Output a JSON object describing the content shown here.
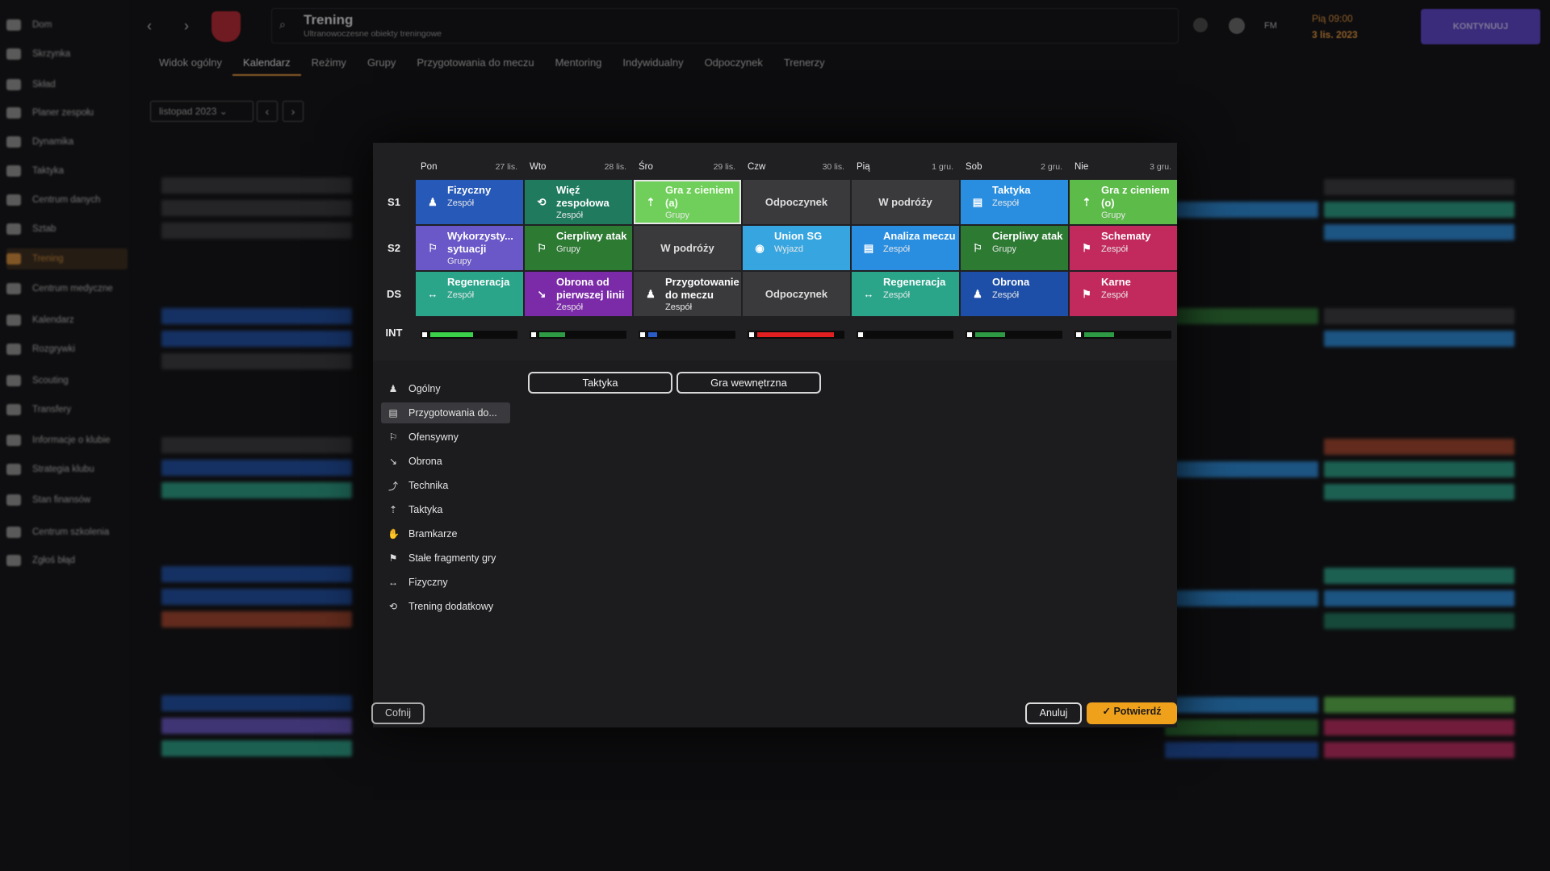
{
  "sidebar": {
    "items": [
      {
        "label": "Dom"
      },
      {
        "label": "Skrzynka"
      },
      {
        "label": "Skład"
      },
      {
        "label": "Planer zespołu"
      },
      {
        "label": "Dynamika"
      },
      {
        "label": "Taktyka"
      },
      {
        "label": "Centrum danych"
      },
      {
        "label": "Sztab"
      },
      {
        "label": "Trening"
      },
      {
        "label": "Centrum medyczne"
      },
      {
        "label": "Kalendarz"
      },
      {
        "label": "Rozgrywki"
      },
      {
        "label": "Scouting"
      },
      {
        "label": "Transfery"
      },
      {
        "label": "Informacje o klubie"
      },
      {
        "label": "Strategia klubu"
      },
      {
        "label": "Stan finansów"
      },
      {
        "label": "Centrum szkolenia"
      },
      {
        "label": "Zgłoś błąd"
      }
    ]
  },
  "header": {
    "title": "Trening",
    "subtitle": "Ultranowoczesne obiekty treningowe",
    "date_line1": "Pią 09:00",
    "date_line2": "3 lis. 2023",
    "continue_label": "KONTYNUUJ",
    "initials": "FM"
  },
  "tabs": [
    {
      "label": "Widok ogólny"
    },
    {
      "label": "Kalendarz"
    },
    {
      "label": "Reżimy"
    },
    {
      "label": "Grupy"
    },
    {
      "label": "Przygotowania do meczu"
    },
    {
      "label": "Mentoring"
    },
    {
      "label": "Indywidualny"
    },
    {
      "label": "Odpoczynek"
    },
    {
      "label": "Trenerzy"
    }
  ],
  "month_selector": {
    "value": "listopad 2023"
  },
  "calendar": {
    "days": [
      {
        "name": "Pon",
        "date": "27 lis."
      },
      {
        "name": "Wto",
        "date": "28 lis."
      },
      {
        "name": "Śro",
        "date": "29 lis."
      },
      {
        "name": "Czw",
        "date": "30 lis."
      },
      {
        "name": "Pią",
        "date": "1 gru."
      },
      {
        "name": "Sob",
        "date": "2 gru."
      },
      {
        "name": "Nie",
        "date": "3 gru."
      }
    ],
    "rows": [
      {
        "label": "S1",
        "cells": [
          {
            "title": "Fizyczny",
            "sub": "Zespół",
            "color": "#2659b8",
            "icon": "person-icon"
          },
          {
            "title": "Więź zespołowa",
            "sub": "Zespół",
            "color": "#1f7a5e",
            "icon": "team-icon"
          },
          {
            "title": "Gra z cieniem (a)",
            "sub": "Grupy",
            "color": "#6fcf5a",
            "icon": "tactics-icon"
          },
          {
            "title": "Odpoczynek",
            "sub": "",
            "color": "#3a3a3d",
            "icon": ""
          },
          {
            "title": "W podróży",
            "sub": "",
            "color": "#3a3a3d",
            "icon": ""
          },
          {
            "title": "Taktyka",
            "sub": "Zespół",
            "color": "#2a8ee0",
            "icon": "clipboard-icon"
          },
          {
            "title": "Gra z cieniem (o)",
            "sub": "Grupy",
            "color": "#5dbb4a",
            "icon": "tactics-icon"
          }
        ]
      },
      {
        "label": "S2",
        "cells": [
          {
            "title": "Wykorzysty... sytuacji",
            "sub": "Grupy",
            "color": "#6a57c8",
            "icon": "run-icon"
          },
          {
            "title": "Cierpliwy atak",
            "sub": "Grupy",
            "color": "#2d7a33",
            "icon": "run-icon"
          },
          {
            "title": "W podróży",
            "sub": "",
            "color": "#3a3a3d",
            "icon": ""
          },
          {
            "title": "Union SG",
            "sub": "Wyjazd",
            "color": "#37a6e0",
            "icon": "club-crest-icon"
          },
          {
            "title": "Analiza meczu",
            "sub": "Zespół",
            "color": "#2a8ee0",
            "icon": "clipboard-icon"
          },
          {
            "title": "Cierpliwy atak",
            "sub": "Grupy",
            "color": "#2d7a33",
            "icon": "run-icon"
          },
          {
            "title": "Schematy",
            "sub": "Zespół",
            "color": "#c22a5e",
            "icon": "flag-icon"
          }
        ]
      },
      {
        "label": "DS",
        "cells": [
          {
            "title": "Regeneracja",
            "sub": "Zespół",
            "color": "#2aa58a",
            "icon": "arrows-icon"
          },
          {
            "title": "Obrona od pierwszej linii",
            "sub": "Zespół",
            "color": "#7b2aa8",
            "icon": "slide-icon"
          },
          {
            "title": "Przygotowanie do meczu",
            "sub": "Zespół",
            "color": "#3a3a3d",
            "icon": "person-icon"
          },
          {
            "title": "Odpoczynek",
            "sub": "",
            "color": "#3a3a3d",
            "icon": ""
          },
          {
            "title": "Regeneracja",
            "sub": "Zespół",
            "color": "#2aa58a",
            "icon": "arrows-icon"
          },
          {
            "title": "Obrona",
            "sub": "Zespół",
            "color": "#1d4fa8",
            "icon": "person-icon"
          },
          {
            "title": "Karne",
            "sub": "Zespół",
            "color": "#c22a5e",
            "icon": "flag-icon"
          }
        ]
      }
    ],
    "int_label": "INT",
    "intensity": [
      {
        "level": 0.5,
        "color": "#3ad04a"
      },
      {
        "level": 0.3,
        "color": "#2f9a44"
      },
      {
        "level": 0.1,
        "color": "#2a5cc8"
      },
      {
        "level": 0.9,
        "color": "#e02020"
      },
      {
        "level": 0.0,
        "color": "#2f9a44"
      },
      {
        "level": 0.35,
        "color": "#2f9a44"
      },
      {
        "level": 0.35,
        "color": "#2f9a44"
      }
    ]
  },
  "categories": [
    {
      "label": "Ogólny",
      "icon": "person-icon"
    },
    {
      "label": "Przygotowania do...",
      "icon": "clipboard-icon"
    },
    {
      "label": "Ofensywny",
      "icon": "run-icon"
    },
    {
      "label": "Obrona",
      "icon": "slide-icon"
    },
    {
      "label": "Technika",
      "icon": "kick-icon"
    },
    {
      "label": "Taktyka",
      "icon": "tactics-icon"
    },
    {
      "label": "Bramkarze",
      "icon": "goalkeeper-icon"
    },
    {
      "label": "Stałe fragmenty gry",
      "icon": "flag-icon"
    },
    {
      "label": "Fizyczny",
      "icon": "arrows-icon"
    },
    {
      "label": "Trening dodatkowy",
      "icon": "team-icon"
    }
  ],
  "sub_buttons": [
    {
      "label": "Taktyka"
    },
    {
      "label": "Gra wewnętrzna"
    }
  ],
  "footer": {
    "back": "Cofnij",
    "cancel": "Anuluj",
    "confirm": "Potwierdź"
  }
}
